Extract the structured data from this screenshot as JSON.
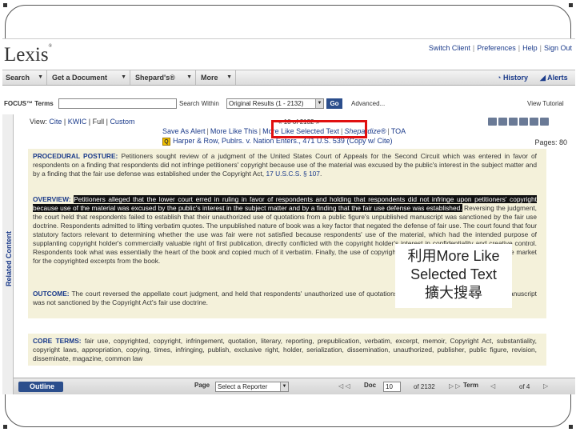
{
  "header": {
    "logo": "Lexis",
    "logo_mark": "®",
    "links": [
      "Switch Client",
      "Preferences",
      "Help",
      "Sign Out"
    ]
  },
  "nav": {
    "items": [
      "Search",
      "Get a Document",
      "Shepard's®",
      "More"
    ],
    "history": "History",
    "alerts": "Alerts"
  },
  "focus": {
    "label": "FOCUS™ Terms",
    "search_within_label": "Search Within",
    "search_within_value": "Original Results (1 - 2132)",
    "go": "Go",
    "advanced": "Advanced...",
    "tutorial": "View Tutorial"
  },
  "gutter_label": "Related Content",
  "view": {
    "label": "View:",
    "options": [
      "Cite",
      "KWIC",
      "Full",
      "Custom"
    ]
  },
  "doc_nav": "« 10 of 2132 »",
  "actions": {
    "save_alert": "Save As Alert",
    "more_like_this": "More Like This",
    "more_like_selected": "More Like Selected Text",
    "shepardize": "Shepardize®",
    "toa": "TOA"
  },
  "case": {
    "title": "Harper & Row, Publrs. v. Nation Enters., 471 U.S. 539",
    "copy_cite": "(Copy w/ Cite)",
    "pages_label": "Pages:",
    "pages_value": "80"
  },
  "document": {
    "procedural_heading": "PROCEDURAL POSTURE:",
    "procedural_text": "Petitioners sought review of a judgment of the United States Court of Appeals for the Second Circuit which was entered in favor of respondents on a finding that respondents did not infringe petitioners' copyright because use of the material was excused by the public's interest in the subject matter and by a finding that the fair use defense was established under the Copyright Act,",
    "procedural_cite": "17 U.S.C.S. § 107",
    "overview_heading": "OVERVIEW:",
    "overview_highlighted": "Petitioners alleged that the lower court erred in ruling in favor of respondents and holding that respondents did not infringe upon petitioners' copyright because use of the material was excused by the public's interest in the subject matter and by a finding that the fair use defense was established.",
    "overview_text": "Reversing the judgment, the court held that respondents failed to establish that their unauthorized use of quotations from a public figure's unpublished manuscript was sanctioned by the fair use doctrine. Respondents admitted to lifting verbatim quotes. The unpublished nature of book was a key factor that negated the defense of fair use. The court found that four statutory factors relevant to determining whether the use was fair were not satisfied because respondents' use of the material, which had the intended purpose of supplanting copyright holder's commercially valuable right of first publication, directly conflicted with the copyright holder's interest in confidentiality and creative control. Respondents took what was essentially the heart of the book and copied much of it verbatim. Finally, the use of copyrighted material had an actual effect on the market for the copyrighted excerpts from the book.",
    "outcome_heading": "OUTCOME:",
    "outcome_text": "The court reversed the appellate court judgment, and held that respondents' unauthorized use of quotations from a public figure's unpublished manuscript was not sanctioned by the Copyright Act's fair use doctrine.",
    "core_heading": "CORE TERMS:",
    "core_text": "fair use, copyrighted, copyright, infringement, quotation, literary, reporting, prepublication, verbatim, excerpt, memoir, Copyright Act, substantiality, copyright laws, appropriation, copying, times, infringing, publish, exclusive right, holder, serialization, dissemination, unauthorized, publisher, public figure, revision, disseminate, magazine, common law"
  },
  "overlay": {
    "line1": "利用More Like",
    "line2": "Selected Text",
    "line3": "擴大搜尋"
  },
  "bottom": {
    "outline": "Outline",
    "page_label": "Page",
    "reporter_placeholder": "Select a Reporter",
    "doc_label": "Doc",
    "doc_value": "10",
    "doc_of": "of 2132",
    "term_label": "Term",
    "term_of": "of 4"
  },
  "colors": {
    "highlight_box": "#e01010",
    "doc_background": "#f4f1da",
    "link_blue": "#1a3a8a",
    "button_blue": "#2b4e8c"
  }
}
